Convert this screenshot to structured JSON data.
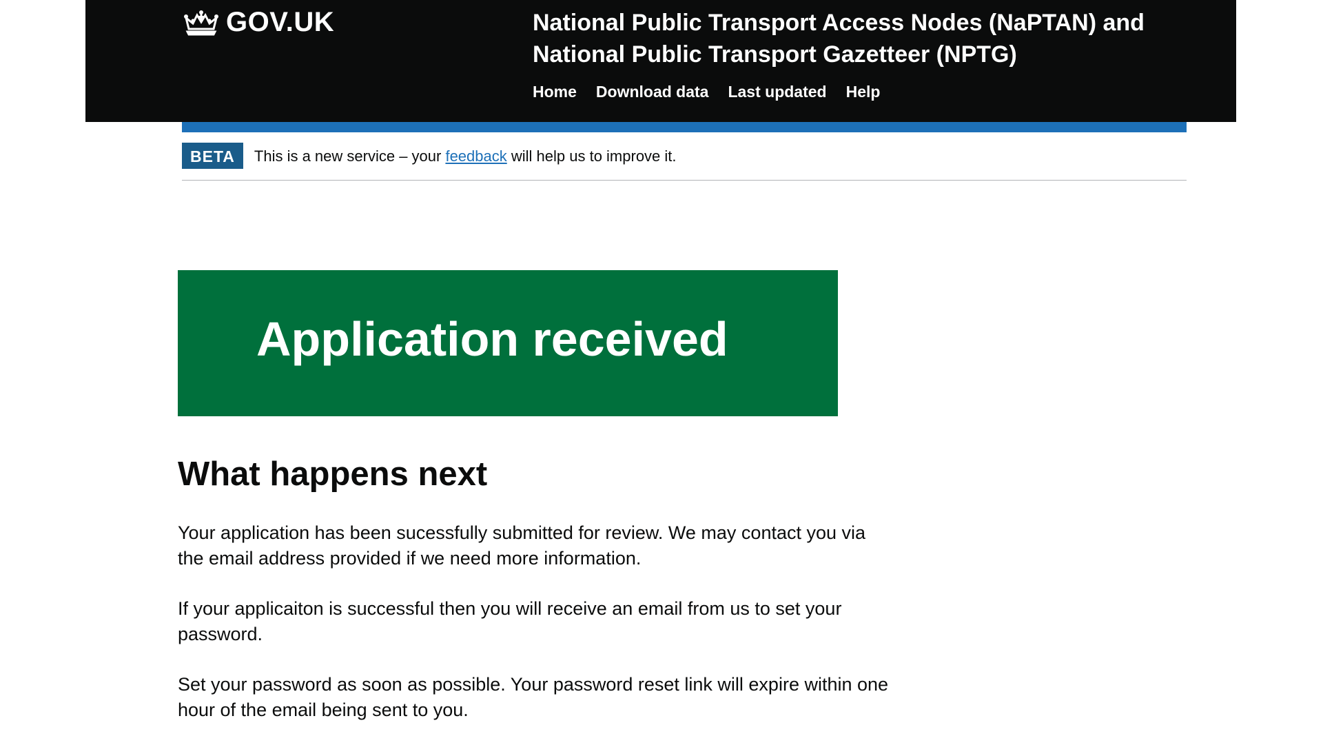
{
  "header": {
    "logo_text": "GOV.UK",
    "service_name_line1": "National Public Transport Access Nodes (NaPTAN) and",
    "service_name_line2": "National Public Transport Gazetteer (NPTG)",
    "nav": [
      {
        "label": "Home"
      },
      {
        "label": "Download data"
      },
      {
        "label": "Last updated"
      },
      {
        "label": "Help"
      }
    ]
  },
  "phase_banner": {
    "tag": "BETA",
    "text_before": "This is a new service – your ",
    "link": "feedback",
    "text_after": " will help us to improve it."
  },
  "panel": {
    "title": "Application received"
  },
  "main": {
    "heading": "What happens next",
    "paragraphs": [
      "Your application has been sucessfully submitted for review. We may contact you via the email address provided if we need more information.",
      "If your applicaiton is successful then you will receive an email from us to set your password.",
      "Set your password as soon as possible. Your password reset link will expire within one hour of the email being sent to you."
    ]
  },
  "colors": {
    "header_bg": "#0b0c0c",
    "accent_blue": "#1d70b8",
    "panel_green": "#00703c"
  }
}
